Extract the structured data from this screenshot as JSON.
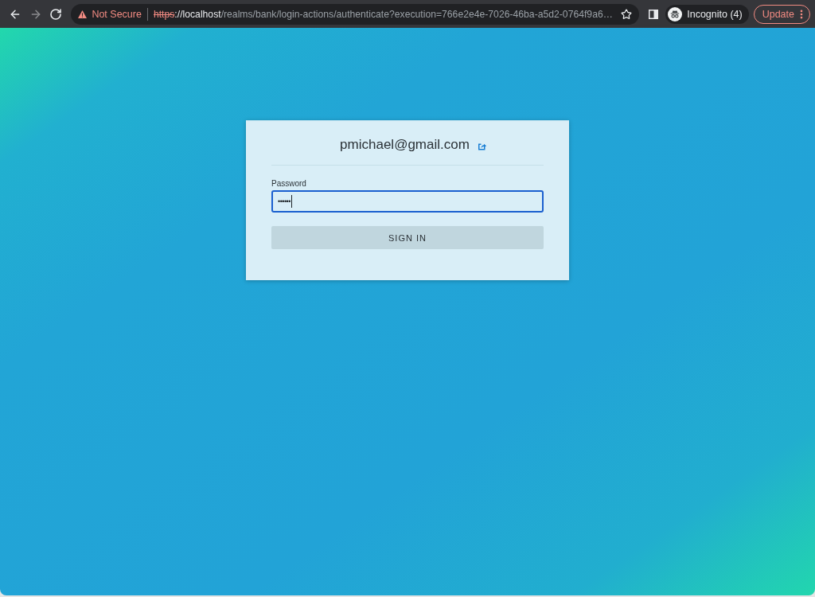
{
  "browser": {
    "nav_buttons": [
      {
        "kind": "back",
        "disabled": false
      },
      {
        "kind": "forward",
        "disabled": true
      },
      {
        "kind": "reload",
        "disabled": false
      }
    ],
    "security_warning": "Not Secure",
    "url": {
      "scheme": "https",
      "host": "://localhost",
      "path": "/realms/bank/login-actions/authenticate?execution=766e2e4e-7026-46ba-a5d2-0764f9a6…"
    },
    "profile": {
      "label": "Incognito (4)"
    },
    "update_button": "Update"
  },
  "login_card": {
    "username": "pmichael@gmail.com",
    "password": {
      "label": "Password",
      "value": "••••••",
      "focused": true
    },
    "submit_button": "SIGN IN"
  }
}
